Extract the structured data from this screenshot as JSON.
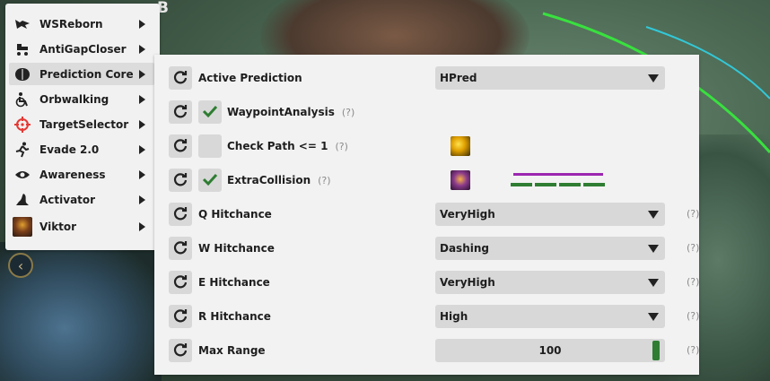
{
  "menu": {
    "items": [
      {
        "label": "WSReborn",
        "icon": "wolf-icon",
        "active": false
      },
      {
        "label": "AntiGapCloser",
        "icon": "stroller-icon",
        "active": false
      },
      {
        "label": "Prediction Core",
        "icon": "brain-icon",
        "active": true
      },
      {
        "label": "Orbwalking",
        "icon": "wheelchair-icon",
        "active": false
      },
      {
        "label": "TargetSelector",
        "icon": "crosshair-icon",
        "active": false
      },
      {
        "label": "Evade 2.0",
        "icon": "running-icon",
        "active": false
      },
      {
        "label": "Awareness",
        "icon": "eye-icon",
        "active": false
      },
      {
        "label": "Activator",
        "icon": "wizard-hat-icon",
        "active": false
      },
      {
        "label": "Viktor",
        "icon": "champion-portrait-icon",
        "active": false
      }
    ]
  },
  "settings": {
    "active_prediction": {
      "label": "Active Prediction",
      "value": "HPred"
    },
    "waypoint_analysis": {
      "label": "WaypointAnalysis",
      "help": "(?)",
      "checked": true
    },
    "check_path": {
      "label": "Check Path <= 1",
      "help": "(?)",
      "checked": false
    },
    "extra_collision": {
      "label": "ExtraCollision",
      "help": "(?)",
      "checked": true
    },
    "q_hitchance": {
      "label": "Q Hitchance",
      "value": "VeryHigh",
      "help": "(?)"
    },
    "w_hitchance": {
      "label": "W Hitchance",
      "value": "Dashing",
      "help": "(?)"
    },
    "e_hitchance": {
      "label": "E Hitchance",
      "value": "VeryHigh",
      "help": "(?)"
    },
    "r_hitchance": {
      "label": "R Hitchance",
      "value": "High",
      "help": "(?)"
    },
    "max_range": {
      "label": "Max Range",
      "value": "100",
      "fill_fraction": 1.0,
      "help": "(?)"
    }
  },
  "colors": {
    "accent_green": "#2e7d32",
    "purple_bar": "#9c27b0",
    "panel_bg": "#f2f2f2",
    "control_bg": "#d8d8d8"
  }
}
